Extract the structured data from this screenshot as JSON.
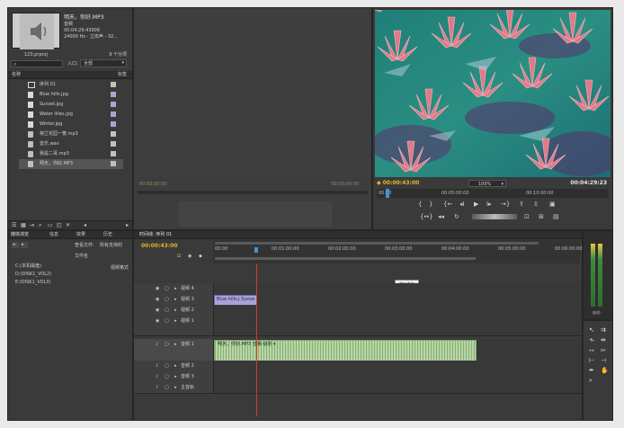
{
  "project": {
    "clip_name": "明天，你好.MP3",
    "clip_type": "音频",
    "clip_duration": "00:04:29:43906",
    "clip_audio": "24000 Hz - 立体声 - 32...",
    "project_file": "123.prproj",
    "item_count": "9 个分项",
    "entry_label": "入口:",
    "entry_value": "全部",
    "col_name": "名称",
    "col_label": "标签",
    "items": [
      {
        "name": "序列 01",
        "type": "seq",
        "color": "#b9c7b7"
      },
      {
        "name": "Blue hills.jpg",
        "type": "img",
        "color": "#a9a4d2"
      },
      {
        "name": "Sunset.jpg",
        "type": "img",
        "color": "#a9a4d2"
      },
      {
        "name": "Water lilies.jpg",
        "type": "img",
        "color": "#a9a4d2"
      },
      {
        "name": "Winter.jpg",
        "type": "img",
        "color": "#a9a4d2"
      },
      {
        "name": "荷兰花园一瞥.mp3",
        "type": "aud",
        "color": "#b9c7b7"
      },
      {
        "name": "音乐.wav",
        "type": "aud",
        "color": "#b9c7b7"
      },
      {
        "name": "我是二哥.mp3",
        "type": "aud",
        "color": "#b9c7b7"
      },
      {
        "name": "明天，你好.MP3",
        "type": "aud",
        "color": "#b9c7b7"
      }
    ]
  },
  "source_monitor": {
    "timecode_left": "00:00:00:00",
    "timecode_right": "00:00:00:00"
  },
  "program_monitor": {
    "current_time": "00:00:43:00",
    "fit": "100%",
    "duration": "00:04:29:23",
    "ruler": [
      "00:00",
      "00:05:00:00",
      "00:10:00:00"
    ]
  },
  "media_browser": {
    "tabs": [
      "媒体浏览",
      "信息",
      "效果",
      "历史"
    ],
    "view_label": "查看文件:",
    "view_value": "所有支持的",
    "col_name": "文件名",
    "col_type": "视频格式",
    "drives": [
      "C:(本机磁盘)",
      "D:(DISK1_VOL2)",
      "E:(DISK1_VOL3)"
    ]
  },
  "timeline": {
    "tabs": [
      "时间线: 序列 01"
    ],
    "current_time": "00:00:43:00",
    "ruler": [
      "00:00",
      "00:01:00:00",
      "00:02:00:00",
      "00:03:00:00",
      "00:04:00:00",
      "00:05:00:00",
      "00:06:00:00"
    ],
    "tooltip": "double",
    "video_tracks": [
      "视频 4",
      "视频 3",
      "视频 2",
      "视频 1"
    ],
    "audio_tracks": [
      "音频 1",
      "音频 2",
      "音频 3"
    ],
    "master_label": "主音轨",
    "video_clip_label": "Blue hills.j Sunse",
    "audio_clip_label": "明天，你好.MP3 音量:级别 ▾"
  },
  "colors": {
    "accent": "#e6b729",
    "panel_bg": "#3a3a3a",
    "video_clip": "#a8a2d8",
    "audio_clip": "#b6d6a2",
    "playhead": "#d83a2a"
  }
}
